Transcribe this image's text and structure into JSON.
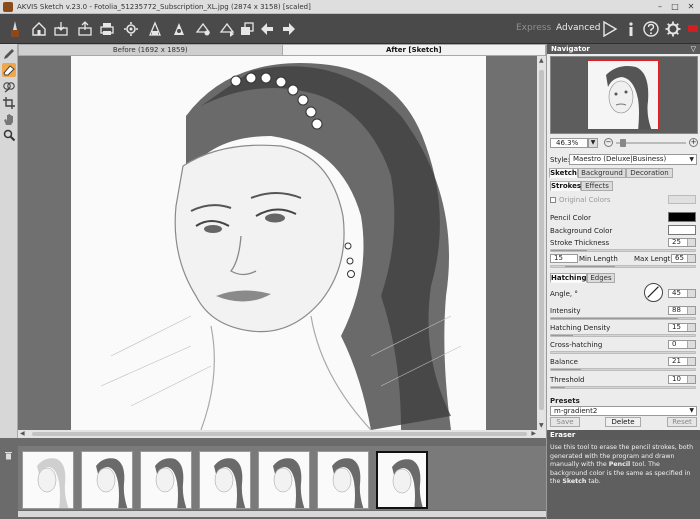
{
  "window": {
    "title": "AKVIS Sketch v.23.0 - Fotolia_51235772_Subscription_XL.jpg (2874 x 3158) [scaled]",
    "minimize": "–",
    "maximize": "□",
    "close": "✕"
  },
  "toolbar": {
    "modes": {
      "express": "Express",
      "advanced": "Advanced"
    },
    "icons": [
      "home-icon",
      "open-file-icon",
      "save-icon",
      "print-icon",
      "batch-icon",
      "presets-icon",
      "run-icon",
      "settings-icon",
      "share-icon",
      "undo-icon",
      "redo-icon"
    ],
    "right_icons": [
      "play-icon",
      "info-icon",
      "help-icon",
      "gear-icon",
      "flag-icon"
    ]
  },
  "left_tools": [
    "pencil-icon",
    "eraser-icon",
    "smudge-icon",
    "crop-icon",
    "hand-icon",
    "zoom-icon"
  ],
  "view_tabs": {
    "before": "Before (1692 x 1859)",
    "after": "After [Sketch]"
  },
  "panel": {
    "navigator": {
      "title": "Navigator",
      "zoom": "46.3%"
    },
    "style": {
      "label": "Style:",
      "value": "Maestro (Deluxe|Business)"
    },
    "main_tabs": [
      "Sketch",
      "Background",
      "Decoration"
    ],
    "sub_tabs": [
      "Strokes",
      "Effects"
    ],
    "original_colors": "Original Colors",
    "pencil_color": {
      "label": "Pencil Color",
      "color": "#000000"
    },
    "background_color": {
      "label": "Background Color",
      "color": "#ffffff"
    },
    "stroke_thickness": {
      "label": "Stroke Thickness",
      "value": "25",
      "fraction": 0.25
    },
    "min_length": {
      "label": "Min Length",
      "value": "15"
    },
    "max_length": {
      "label": "Max Length",
      "value": "65"
    },
    "hatch_tabs": [
      "Hatching",
      "Edges"
    ],
    "angle": {
      "label": "Angle, °",
      "value": "45"
    },
    "intensity": {
      "label": "Intensity",
      "value": "88",
      "fraction": 0.88
    },
    "hatching_density": {
      "label": "Hatching Density",
      "value": "15",
      "fraction": 0.15
    },
    "cross_hatching": {
      "label": "Cross-hatching",
      "value": "0",
      "fraction": 0.0
    },
    "balance": {
      "label": "Balance",
      "value": "21",
      "fraction": 0.21
    },
    "threshold": {
      "label": "Threshold",
      "value": "10",
      "fraction": 0.1
    },
    "presets": {
      "title": "Presets",
      "value": "m-gradient2",
      "save": "Save",
      "delete": "Delete",
      "reset": "Reset"
    },
    "hint": {
      "title": "Eraser",
      "p1": "Use this tool to erase the pencil strokes, both generated with the program and drawn manually with the ",
      "b1": "Pencil",
      "p2": " tool. The background color is the same as specified in the ",
      "b2": "Sketch",
      "p3": " tab."
    }
  },
  "filmstrip": {
    "count": 7,
    "selected": 6
  }
}
